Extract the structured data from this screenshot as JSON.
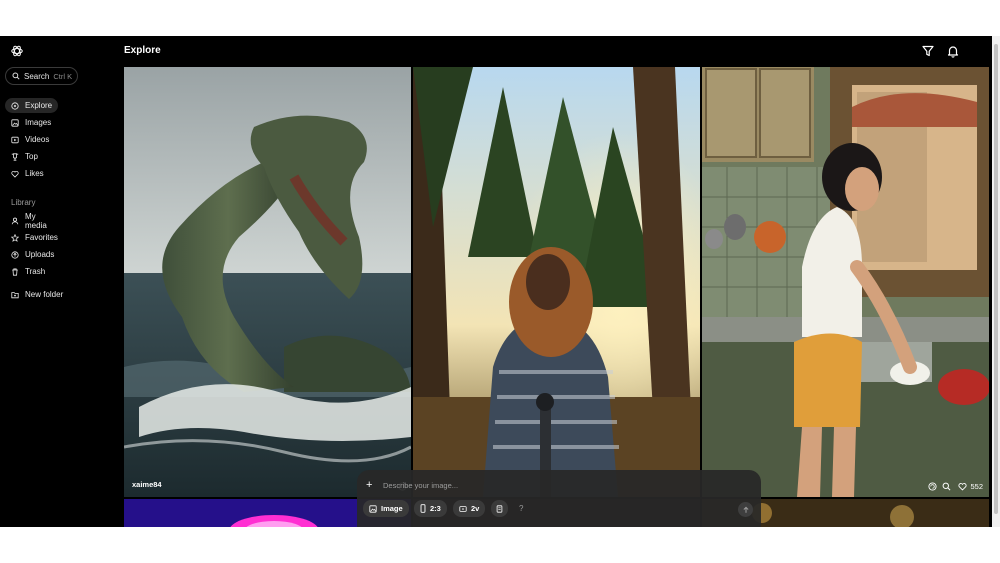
{
  "sidebar": {
    "search": {
      "label": "Search",
      "shortcut": "Ctrl K"
    },
    "nav": [
      {
        "label": "Explore",
        "icon": "compass-icon",
        "active": true
      },
      {
        "label": "Images",
        "icon": "image-icon"
      },
      {
        "label": "Videos",
        "icon": "video-icon"
      },
      {
        "label": "Top",
        "icon": "trophy-icon"
      },
      {
        "label": "Likes",
        "icon": "heart-icon"
      }
    ],
    "library_title": "Library",
    "library": [
      {
        "label": "My media",
        "icon": "user-icon"
      },
      {
        "label": "Favorites",
        "icon": "star-icon"
      },
      {
        "label": "Uploads",
        "icon": "upload-icon"
      },
      {
        "label": "Trash",
        "icon": "trash-icon"
      }
    ],
    "new_folder": "New folder"
  },
  "header": {
    "title": "Explore",
    "icons": [
      "filter-icon",
      "bell-icon"
    ]
  },
  "feed": [
    {
      "user": "xaime84",
      "subject": "sea serpent rising from stormy waves"
    },
    {
      "subject": "bigfoot taking a selfie in a pine forest"
    },
    {
      "subject": "woman washing dishes at a kitchen sink",
      "likes": "552"
    }
  ],
  "composer": {
    "placeholder": "Describe your image...",
    "mode": "Image",
    "aspect": "2:3",
    "variants": "2v",
    "help": "?"
  },
  "colors": {
    "background": "#000000",
    "accent": "#ffffff",
    "panel": "#282828"
  }
}
